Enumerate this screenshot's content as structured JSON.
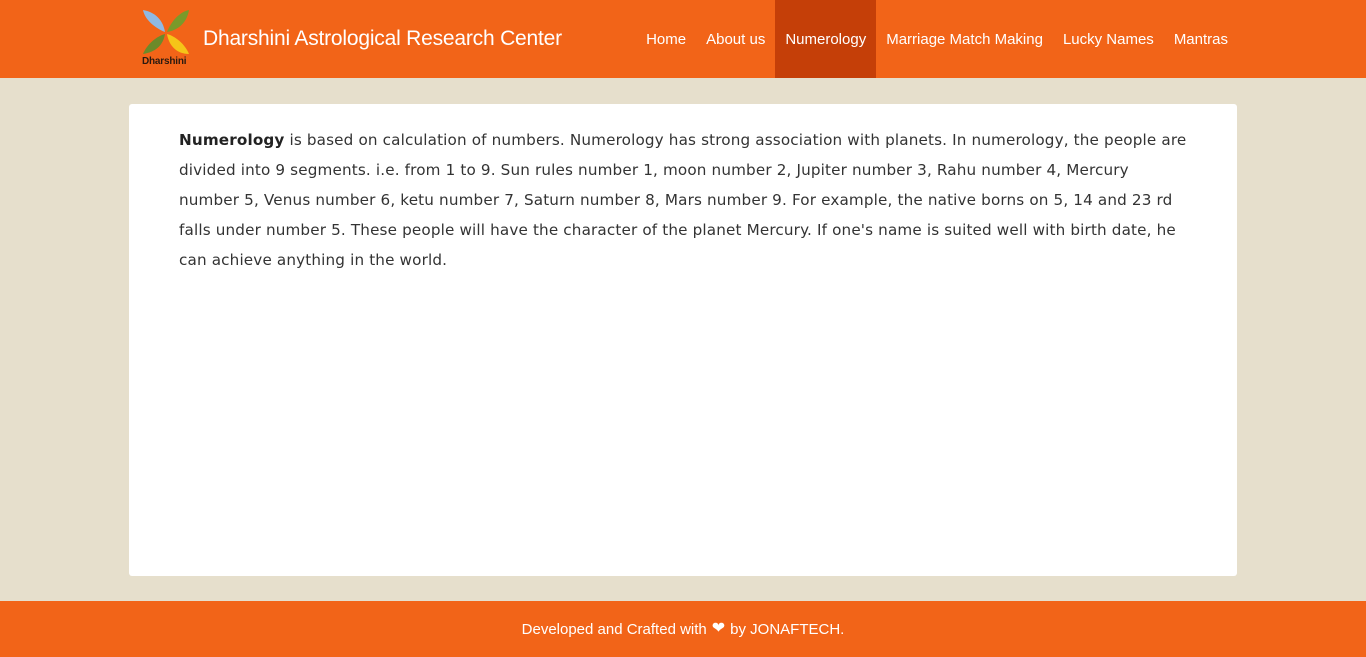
{
  "colors": {
    "primary": "#f26418",
    "active_nav": "#c53f08",
    "page_background": "#e6dfcc",
    "card_background": "#ffffff"
  },
  "brand": {
    "title": "Dharshini Astrological Research Center",
    "logo_text": "Dharshini",
    "logo_icon": "four-leaf-logo-icon"
  },
  "nav": {
    "items": [
      {
        "label": "Home",
        "active": false
      },
      {
        "label": "About us",
        "active": false
      },
      {
        "label": "Numerology",
        "active": true
      },
      {
        "label": "Marriage Match Making",
        "active": false
      },
      {
        "label": "Lucky Names",
        "active": false
      },
      {
        "label": "Mantras",
        "active": false
      }
    ]
  },
  "main": {
    "heading_bold": "Numerology",
    "body": " is based on calculation of numbers. Numerology has strong association with planets. In numerology, the people are divided into 9 segments. i.e. from 1 to 9. Sun rules number 1, moon number 2, Jupiter number 3, Rahu number 4, Mercury number 5, Venus number 6, ketu number 7, Saturn number 8, Mars number 9. For example, the native borns on 5, 14 and 23 rd falls under number 5. These people will have the character of the planet Mercury. If one's name is suited well with birth date, he can achieve anything in the world."
  },
  "footer": {
    "text_before": "Developed and Crafted with",
    "heart_icon": "heart-icon",
    "heart_glyph": "❤",
    "text_after": "by JONAFTECH."
  }
}
